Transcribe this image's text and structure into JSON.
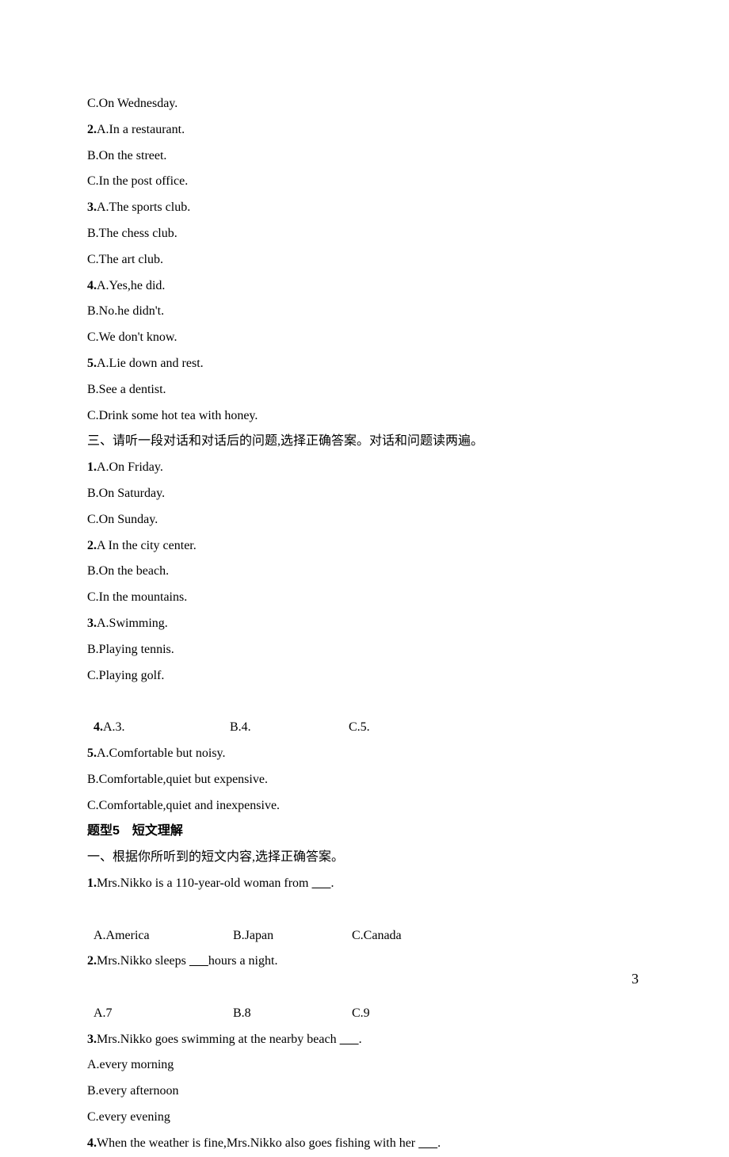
{
  "page_number": "3",
  "blank": "      ",
  "sec2": {
    "q1c": "C.On Wednesday.",
    "q2n": "2.",
    "q2a": "A.In a restaurant.",
    "q2b": "B.On the street.",
    "q2c": "C.In the post office.",
    "q3n": "3.",
    "q3a": "A.The sports club.",
    "q3b": "B.The chess club.",
    "q3c": "C.The art club.",
    "q4n": "4.",
    "q4a": "A.Yes,he did.",
    "q4b": "B.No.he didn't.",
    "q4c": "C.We don't know.",
    "q5n": "5.",
    "q5a": "A.Lie down and rest.",
    "q5b": "B.See a dentist.",
    "q5c": "C.Drink some hot tea with honey."
  },
  "sec3": {
    "heading": "三、请听一段对话和对话后的问题,选择正确答案。对话和问题读两遍。",
    "q1n": "1.",
    "q1a": "A.On Friday.",
    "q1b": "B.On Saturday.",
    "q1c": "C.On Sunday.",
    "q2n": "2.",
    "q2a": "A In the city center.",
    "q2b": "B.On the beach.",
    "q2c": "C.In the mountains.",
    "q3n": "3.",
    "q3a": "A.Swimming.",
    "q3b": "B.Playing tennis.",
    "q3c": "C.Playing golf.",
    "q4n": "4.",
    "q4a": "A.3.",
    "q4b": "B.4.",
    "q4c": "C.5.",
    "q5n": "5.",
    "q5a": "A.Comfortable but noisy.",
    "q5b": "B.Comfortable,quiet but expensive.",
    "q5c": "C.Comfortable,quiet and inexpensive."
  },
  "type5": {
    "title": "题型5　短文理解",
    "heading": "一、根据你所听到的短文内容,选择正确答案。",
    "q1n": "1.",
    "q1text_a": "Mrs.Nikko is a 110-year-old woman from ",
    "q1text_b": ".",
    "q1a": "A.America",
    "q1b": "B.Japan",
    "q1c": "C.Canada",
    "q2n": "2.",
    "q2text_a": "Mrs.Nikko sleeps ",
    "q2text_b": "hours a night.",
    "q2a": "A.7",
    "q2b": "B.8",
    "q2c": "C.9",
    "q3n": "3.",
    "q3text_a": "Mrs.Nikko goes swimming at the nearby beach ",
    "q3text_b": ".",
    "q3a": "A.every morning",
    "q3b": "B.every afternoon",
    "q3c": "C.every evening",
    "q4n": "4.",
    "q4text_a": "When the weather is fine,Mrs.Nikko also goes fishing with her ",
    "q4text_b": "."
  }
}
